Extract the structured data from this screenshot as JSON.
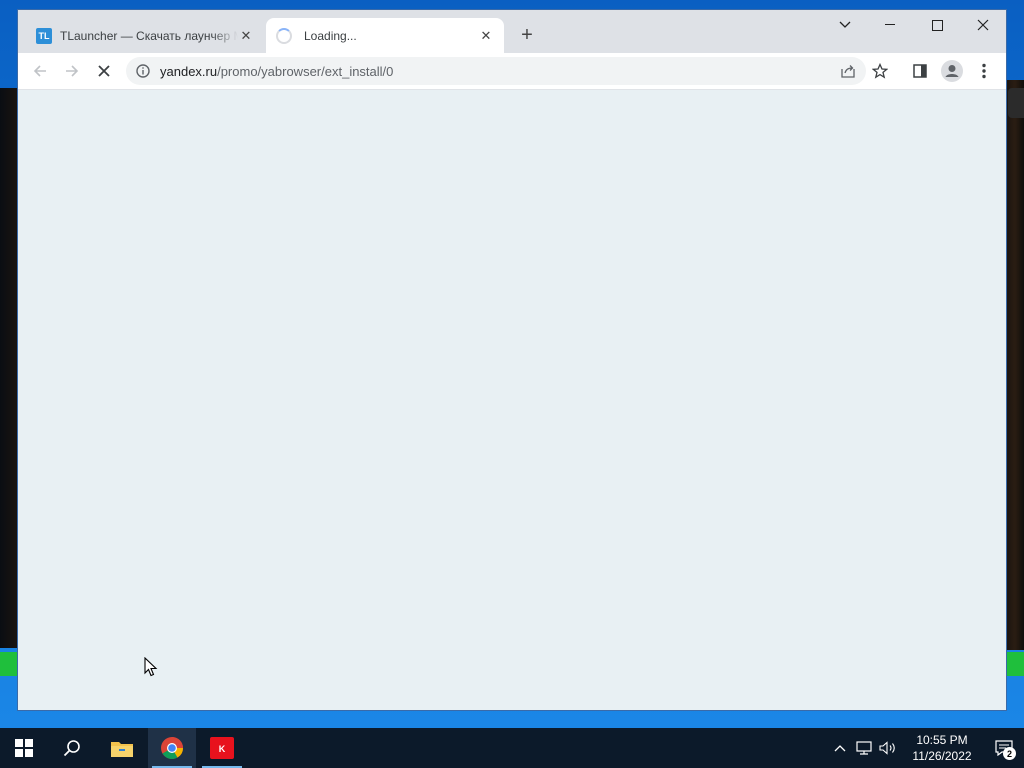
{
  "browser": {
    "tabs": [
      {
        "title": "TLauncher — Скачать лаунчер Майнкрафт",
        "favicon_text": "TL",
        "active": false
      },
      {
        "title": "Loading...",
        "active": true
      }
    ],
    "new_tab_label": "+",
    "address": {
      "host": "yandex.ru",
      "path": "/promo/yabrowser/ext_install/0"
    },
    "icons": {
      "back": "arrow-left-icon",
      "forward": "arrow-right-icon",
      "stop": "close-icon",
      "info": "info-icon",
      "share": "share-icon",
      "bookmark": "star-icon",
      "side_panel": "side-panel-icon",
      "profile": "profile-icon",
      "menu": "kebab-menu-icon"
    }
  },
  "taskbar": {
    "clock": {
      "time": "10:55 PM",
      "date": "11/26/2022"
    },
    "notification_count": "2",
    "apps": [
      "start",
      "search",
      "file-explorer",
      "chrome",
      "kaspersky"
    ]
  },
  "colors": {
    "content_bg": "#e8f0f3",
    "tabstrip_bg": "#dee1e6",
    "taskbar_bg": "#0c1a2a"
  }
}
